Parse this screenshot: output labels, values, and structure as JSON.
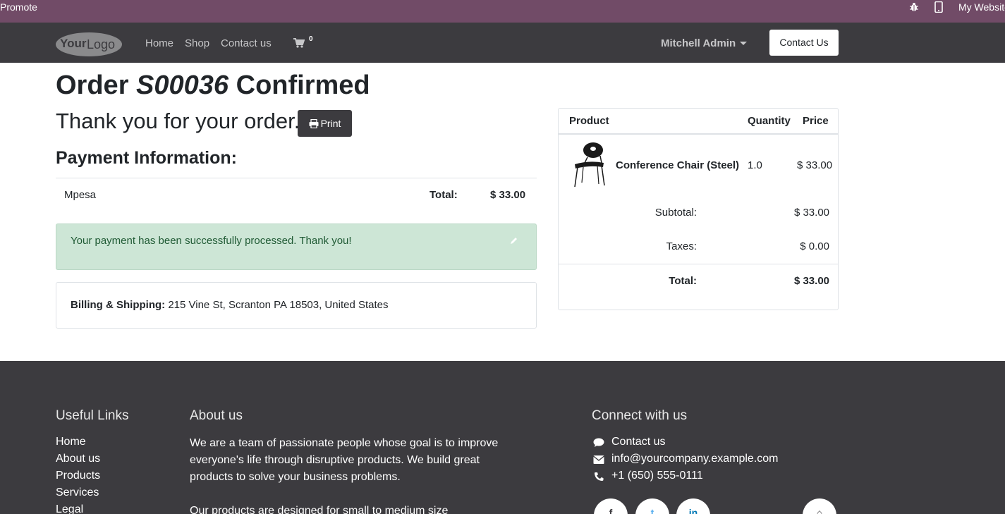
{
  "adminbar": {
    "promote": "Promote",
    "my_website": "My Website",
    "bug_icon": "bug-icon",
    "mobile_icon": "mobile-icon"
  },
  "navbar": {
    "logo_text": "YourLogo",
    "links": [
      "Home",
      "Shop",
      "Contact us"
    ],
    "cart_count": "0",
    "user": "Mitchell Admin",
    "contact_button": "Contact Us"
  },
  "order": {
    "title_prefix": "Order ",
    "order_ref": "S00036",
    "title_suffix": " Confirmed",
    "thanks": "Thank you for your order.",
    "print_label": "Print",
    "payment_heading": "Payment Information:",
    "payment_method": "Mpesa",
    "total_label": "Total:",
    "total_value": "$ 33.00",
    "alert": "Your payment has been successfully processed. Thank you!",
    "billing_label": "Billing & Shipping:",
    "billing_address": "215 Vine St, Scranton PA 18503, United States"
  },
  "summary": {
    "headers": {
      "product": "Product",
      "quantity": "Quantity",
      "price": "Price"
    },
    "item": {
      "name": "Conference Chair (Steel)",
      "qty": "1.0",
      "price": "$ 33.00"
    },
    "subtotal_label": "Subtotal:",
    "subtotal_value": "$ 33.00",
    "taxes_label": "Taxes:",
    "taxes_value": "$ 0.00",
    "total_label": "Total:",
    "total_value": "$ 33.00"
  },
  "footer": {
    "useful_links_heading": "Useful Links",
    "useful_links": [
      "Home",
      "About us",
      "Products",
      "Services",
      "Legal"
    ],
    "about_heading": "About us",
    "about_text": "We are a team of passionate people whose goal is to improve everyone's life through disruptive products. We build great products to solve your business problems.",
    "about_text2": "Our products are designed for small to medium size",
    "connect_heading": "Connect with us",
    "contact_us": "Contact us",
    "email": "info@yourcompany.example.com",
    "phone": "+1 (650) 555-0111"
  },
  "colors": {
    "admin_bar": "#714b67",
    "navbar": "#3c3b3f",
    "success_bg": "#cde6d6",
    "success_text": "#1f5a34"
  }
}
